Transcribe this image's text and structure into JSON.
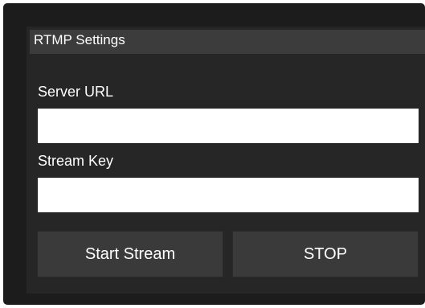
{
  "panel": {
    "title": "RTMP Settings"
  },
  "fields": {
    "server_url": {
      "label": "Server URL",
      "value": "",
      "placeholder": ""
    },
    "stream_key": {
      "label": "Stream Key",
      "value": "",
      "placeholder": ""
    }
  },
  "buttons": {
    "start_label": "Start Stream",
    "stop_label": "STOP"
  },
  "colors": {
    "frame_bg": "#1c1c1c",
    "panel_bg": "#262626",
    "header_bg": "#3c3c3c",
    "button_bg": "#3a3a3a",
    "text": "#ffffff",
    "input_bg": "#ffffff"
  }
}
